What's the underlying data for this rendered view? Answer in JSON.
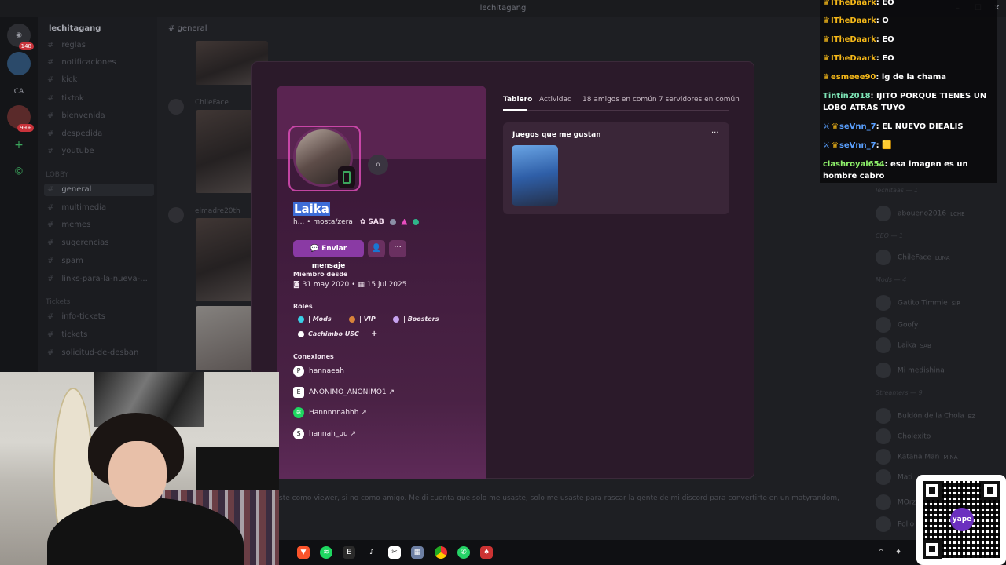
{
  "window": {
    "title": "lechitagang"
  },
  "server": {
    "name": "lechitagang"
  },
  "rail": {
    "servers": [
      {
        "badge": "148"
      },
      {
        "label": "CA"
      },
      {
        "badge": "99+"
      }
    ]
  },
  "channels": [
    {
      "name": "reglas"
    },
    {
      "name": "notificaciones"
    },
    {
      "name": "kick"
    },
    {
      "name": "tiktok"
    },
    {
      "name": "bienvenida"
    },
    {
      "name": "despedida"
    },
    {
      "name": "youtube"
    }
  ],
  "lobby": {
    "category": "LOBBY",
    "channels": [
      {
        "name": "general",
        "active": true
      },
      {
        "name": "multimedia"
      },
      {
        "name": "memes"
      },
      {
        "name": "sugerencias"
      },
      {
        "name": "spam"
      },
      {
        "name": "links-para-la-nueva-..."
      }
    ]
  },
  "tickets": {
    "category": "Tickets",
    "channels": [
      {
        "name": "info-tickets"
      },
      {
        "name": "tickets"
      },
      {
        "name": "solicitud-de-desban"
      }
    ]
  },
  "chat": {
    "channel": "general",
    "last_message": "ste como viewer, si no como amigo. Me di cuenta que solo me usaste, solo me usaste para rascar la gente de mi discord para convertirte en un matyrandom,",
    "authors": [
      "ChileFace",
      "elmadre20th"
    ]
  },
  "profile": {
    "display_name": "Laika",
    "username": "h...",
    "pronouns": "mosta/zera",
    "tag": "SAB",
    "status": "o",
    "send_message": "Enviar mensaje",
    "member_since_label": "Miembro desde",
    "discord_since": "31 may 2020",
    "server_since": "15 jul 2025",
    "roles_label": "Roles",
    "roles": [
      {
        "name": "| Mods",
        "color": "#3ad0e8"
      },
      {
        "name": "| VIP",
        "color": "#d9833a"
      },
      {
        "name": "| Boosters",
        "color": "#c7a3f0"
      },
      {
        "name": "Cachimbo USC",
        "color": "#ffffff"
      }
    ],
    "add_role": "+",
    "connections_label": "Conexiones",
    "connections": [
      {
        "service": "playstation",
        "name": "hannaeah"
      },
      {
        "service": "epic",
        "name": "ANONIMO_ANONIMO1 ↗"
      },
      {
        "service": "spotify",
        "name": "Hannnnnahhh ↗"
      },
      {
        "service": "steam",
        "name": "hannah_uu ↗"
      }
    ]
  },
  "profile_tabs": {
    "tabs": [
      "Tablero",
      "Actividad",
      "18 amigos en común",
      "7 servidores en común"
    ],
    "games_title": "Juegos que me gustan"
  },
  "members": {
    "entries": [
      {
        "name": "lechitaas — 1",
        "type": "cat"
      },
      {
        "name": "aboueno2016",
        "tag": "LCHE"
      },
      {
        "name": "CEO — 1",
        "type": "cat"
      },
      {
        "name": "ChileFace",
        "tag": "LUNA"
      },
      {
        "name": "Mods — 4",
        "type": "cat"
      },
      {
        "name": "Gatito Timmie",
        "tag": "SIR"
      },
      {
        "name": "Goofy"
      },
      {
        "name": "Laika",
        "tag": "SAB"
      },
      {
        "name": "Mi medishina"
      },
      {
        "name": "Streamers — 9",
        "type": "cat"
      },
      {
        "name": "Buldón de la Chola",
        "tag": "EZ"
      },
      {
        "name": "Cholexito"
      },
      {
        "name": "Katana Man",
        "tag": "MINA"
      },
      {
        "name": "Mati"
      },
      {
        "name": "MOrz"
      },
      {
        "name": "Pollo"
      }
    ]
  },
  "stream_chat": [
    {
      "user": "ITheDaark",
      "icon": "crown",
      "color": "#f5b819",
      "text": "EO"
    },
    {
      "user": "ITheDaark",
      "icon": "crown",
      "color": "#f5b819",
      "text": "O"
    },
    {
      "user": "ITheDaark",
      "icon": "crown",
      "color": "#f5b819",
      "text": "EO"
    },
    {
      "user": "ITheDaark",
      "icon": "crown",
      "color": "#f5b819",
      "text": "EO"
    },
    {
      "user": "esmeee90",
      "icon": "crown",
      "color": "#f5b819",
      "text": "lg de la chama"
    },
    {
      "user": "Tintin2018",
      "icon": "",
      "color": "#7de3b5",
      "text": "IJITO PORQUE TIENES UN LOBO ATRAS TUYO"
    },
    {
      "user": "seVnn_7",
      "icon": "sword-crown",
      "color": "#5aa0ff",
      "text": "EL NUEVO DIEALIS"
    },
    {
      "user": "seVnn_7",
      "icon": "sword-crown",
      "color": "#5aa0ff",
      "text": "🟨"
    },
    {
      "user": "clashroyal654",
      "icon": "",
      "color": "#8ef06a",
      "text": "esa imagen es un hombre cabro"
    }
  ],
  "qr": {
    "logo": "yape"
  },
  "taskbar": {
    "apps": [
      "brave",
      "spotify",
      "epic",
      "tiktok",
      "capcut",
      "calculator",
      "chrome",
      "whatsapp",
      "game"
    ]
  },
  "colors": {
    "accent": "#8a3aa4",
    "profile_bg": "#5a2451",
    "online": "#3ba55c"
  }
}
